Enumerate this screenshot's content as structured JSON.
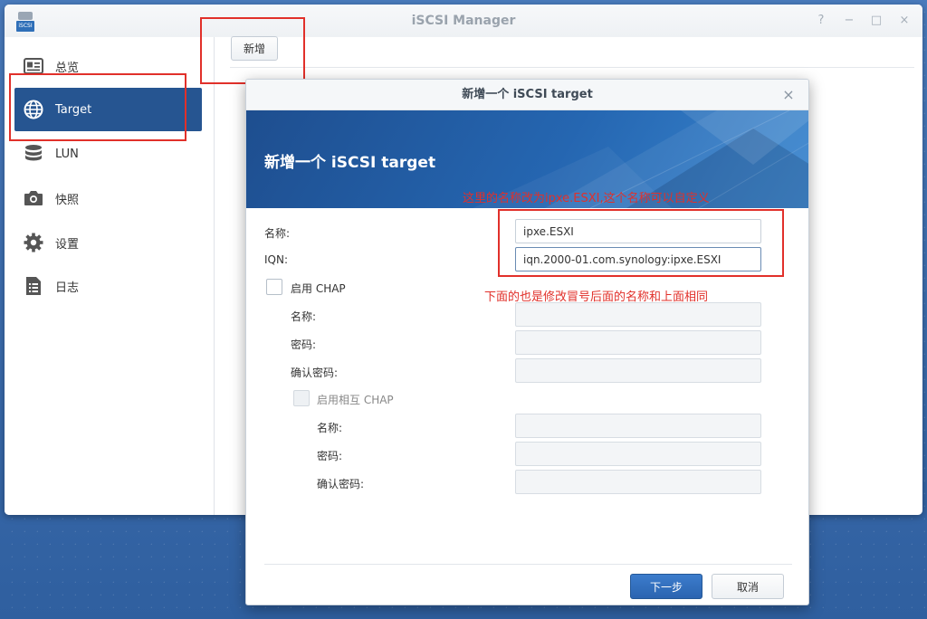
{
  "window": {
    "title": "iSCSI Manager",
    "app_icon_label": "iSCSI",
    "controls": {
      "help": "?",
      "minimize": "−",
      "maximize": "□",
      "close": "×"
    }
  },
  "sidebar": {
    "items": [
      {
        "label": "总览",
        "icon": "overview-icon",
        "active": false
      },
      {
        "label": "Target",
        "icon": "globe-icon",
        "active": true
      },
      {
        "label": "LUN",
        "icon": "database-icon",
        "active": false
      },
      {
        "label": "快照",
        "icon": "camera-icon",
        "active": false
      },
      {
        "label": "设置",
        "icon": "gear-icon",
        "active": false
      },
      {
        "label": "日志",
        "icon": "log-icon",
        "active": false
      }
    ]
  },
  "toolbar": {
    "add_label": "新增"
  },
  "annotations": {
    "name_note": "这里的名称改为ipxe.ESXI,这个名称可以自定义",
    "iqn_note": "下面的也是修改冒号后面的名称和上面相同",
    "color": "#e1302a"
  },
  "dialog": {
    "title": "新增一个 iSCSI target",
    "banner_title": "新增一个 iSCSI target",
    "close": "×",
    "fields": {
      "name_label": "名称:",
      "name_value": "ipxe.ESXI",
      "iqn_label": "IQN:",
      "iqn_value": "iqn.2000-01.com.synology:ipxe.ESXI"
    },
    "chap": {
      "enable_label": "启用 CHAP",
      "name_label": "名称:",
      "password_label": "密码:",
      "confirm_label": "确认密码:"
    },
    "mutual_chap": {
      "enable_label": "启用相互 CHAP",
      "name_label": "名称:",
      "password_label": "密码:",
      "confirm_label": "确认密码:"
    },
    "buttons": {
      "next": "下一步",
      "cancel": "取消"
    }
  },
  "colors": {
    "sidebar_active": "#265591",
    "banner": "#2566b1",
    "primary_button": "#2b64b0"
  }
}
